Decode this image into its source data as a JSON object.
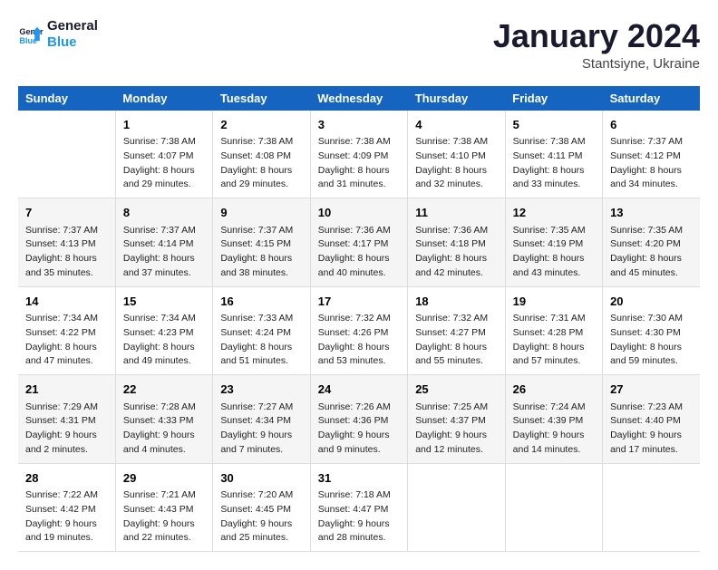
{
  "header": {
    "logo_line1": "General",
    "logo_line2": "Blue",
    "month": "January 2024",
    "location": "Stantsiyne, Ukraine"
  },
  "columns": [
    "Sunday",
    "Monday",
    "Tuesday",
    "Wednesday",
    "Thursday",
    "Friday",
    "Saturday"
  ],
  "weeks": [
    [
      {
        "day": "",
        "sunrise": "",
        "sunset": "",
        "daylight": ""
      },
      {
        "day": "1",
        "sunrise": "Sunrise: 7:38 AM",
        "sunset": "Sunset: 4:07 PM",
        "daylight": "Daylight: 8 hours and 29 minutes."
      },
      {
        "day": "2",
        "sunrise": "Sunrise: 7:38 AM",
        "sunset": "Sunset: 4:08 PM",
        "daylight": "Daylight: 8 hours and 29 minutes."
      },
      {
        "day": "3",
        "sunrise": "Sunrise: 7:38 AM",
        "sunset": "Sunset: 4:09 PM",
        "daylight": "Daylight: 8 hours and 31 minutes."
      },
      {
        "day": "4",
        "sunrise": "Sunrise: 7:38 AM",
        "sunset": "Sunset: 4:10 PM",
        "daylight": "Daylight: 8 hours and 32 minutes."
      },
      {
        "day": "5",
        "sunrise": "Sunrise: 7:38 AM",
        "sunset": "Sunset: 4:11 PM",
        "daylight": "Daylight: 8 hours and 33 minutes."
      },
      {
        "day": "6",
        "sunrise": "Sunrise: 7:37 AM",
        "sunset": "Sunset: 4:12 PM",
        "daylight": "Daylight: 8 hours and 34 minutes."
      }
    ],
    [
      {
        "day": "7",
        "sunrise": "Sunrise: 7:37 AM",
        "sunset": "Sunset: 4:13 PM",
        "daylight": "Daylight: 8 hours and 35 minutes."
      },
      {
        "day": "8",
        "sunrise": "Sunrise: 7:37 AM",
        "sunset": "Sunset: 4:14 PM",
        "daylight": "Daylight: 8 hours and 37 minutes."
      },
      {
        "day": "9",
        "sunrise": "Sunrise: 7:37 AM",
        "sunset": "Sunset: 4:15 PM",
        "daylight": "Daylight: 8 hours and 38 minutes."
      },
      {
        "day": "10",
        "sunrise": "Sunrise: 7:36 AM",
        "sunset": "Sunset: 4:17 PM",
        "daylight": "Daylight: 8 hours and 40 minutes."
      },
      {
        "day": "11",
        "sunrise": "Sunrise: 7:36 AM",
        "sunset": "Sunset: 4:18 PM",
        "daylight": "Daylight: 8 hours and 42 minutes."
      },
      {
        "day": "12",
        "sunrise": "Sunrise: 7:35 AM",
        "sunset": "Sunset: 4:19 PM",
        "daylight": "Daylight: 8 hours and 43 minutes."
      },
      {
        "day": "13",
        "sunrise": "Sunrise: 7:35 AM",
        "sunset": "Sunset: 4:20 PM",
        "daylight": "Daylight: 8 hours and 45 minutes."
      }
    ],
    [
      {
        "day": "14",
        "sunrise": "Sunrise: 7:34 AM",
        "sunset": "Sunset: 4:22 PM",
        "daylight": "Daylight: 8 hours and 47 minutes."
      },
      {
        "day": "15",
        "sunrise": "Sunrise: 7:34 AM",
        "sunset": "Sunset: 4:23 PM",
        "daylight": "Daylight: 8 hours and 49 minutes."
      },
      {
        "day": "16",
        "sunrise": "Sunrise: 7:33 AM",
        "sunset": "Sunset: 4:24 PM",
        "daylight": "Daylight: 8 hours and 51 minutes."
      },
      {
        "day": "17",
        "sunrise": "Sunrise: 7:32 AM",
        "sunset": "Sunset: 4:26 PM",
        "daylight": "Daylight: 8 hours and 53 minutes."
      },
      {
        "day": "18",
        "sunrise": "Sunrise: 7:32 AM",
        "sunset": "Sunset: 4:27 PM",
        "daylight": "Daylight: 8 hours and 55 minutes."
      },
      {
        "day": "19",
        "sunrise": "Sunrise: 7:31 AM",
        "sunset": "Sunset: 4:28 PM",
        "daylight": "Daylight: 8 hours and 57 minutes."
      },
      {
        "day": "20",
        "sunrise": "Sunrise: 7:30 AM",
        "sunset": "Sunset: 4:30 PM",
        "daylight": "Daylight: 8 hours and 59 minutes."
      }
    ],
    [
      {
        "day": "21",
        "sunrise": "Sunrise: 7:29 AM",
        "sunset": "Sunset: 4:31 PM",
        "daylight": "Daylight: 9 hours and 2 minutes."
      },
      {
        "day": "22",
        "sunrise": "Sunrise: 7:28 AM",
        "sunset": "Sunset: 4:33 PM",
        "daylight": "Daylight: 9 hours and 4 minutes."
      },
      {
        "day": "23",
        "sunrise": "Sunrise: 7:27 AM",
        "sunset": "Sunset: 4:34 PM",
        "daylight": "Daylight: 9 hours and 7 minutes."
      },
      {
        "day": "24",
        "sunrise": "Sunrise: 7:26 AM",
        "sunset": "Sunset: 4:36 PM",
        "daylight": "Daylight: 9 hours and 9 minutes."
      },
      {
        "day": "25",
        "sunrise": "Sunrise: 7:25 AM",
        "sunset": "Sunset: 4:37 PM",
        "daylight": "Daylight: 9 hours and 12 minutes."
      },
      {
        "day": "26",
        "sunrise": "Sunrise: 7:24 AM",
        "sunset": "Sunset: 4:39 PM",
        "daylight": "Daylight: 9 hours and 14 minutes."
      },
      {
        "day": "27",
        "sunrise": "Sunrise: 7:23 AM",
        "sunset": "Sunset: 4:40 PM",
        "daylight": "Daylight: 9 hours and 17 minutes."
      }
    ],
    [
      {
        "day": "28",
        "sunrise": "Sunrise: 7:22 AM",
        "sunset": "Sunset: 4:42 PM",
        "daylight": "Daylight: 9 hours and 19 minutes."
      },
      {
        "day": "29",
        "sunrise": "Sunrise: 7:21 AM",
        "sunset": "Sunset: 4:43 PM",
        "daylight": "Daylight: 9 hours and 22 minutes."
      },
      {
        "day": "30",
        "sunrise": "Sunrise: 7:20 AM",
        "sunset": "Sunset: 4:45 PM",
        "daylight": "Daylight: 9 hours and 25 minutes."
      },
      {
        "day": "31",
        "sunrise": "Sunrise: 7:18 AM",
        "sunset": "Sunset: 4:47 PM",
        "daylight": "Daylight: 9 hours and 28 minutes."
      },
      {
        "day": "",
        "sunrise": "",
        "sunset": "",
        "daylight": ""
      },
      {
        "day": "",
        "sunrise": "",
        "sunset": "",
        "daylight": ""
      },
      {
        "day": "",
        "sunrise": "",
        "sunset": "",
        "daylight": ""
      }
    ]
  ]
}
